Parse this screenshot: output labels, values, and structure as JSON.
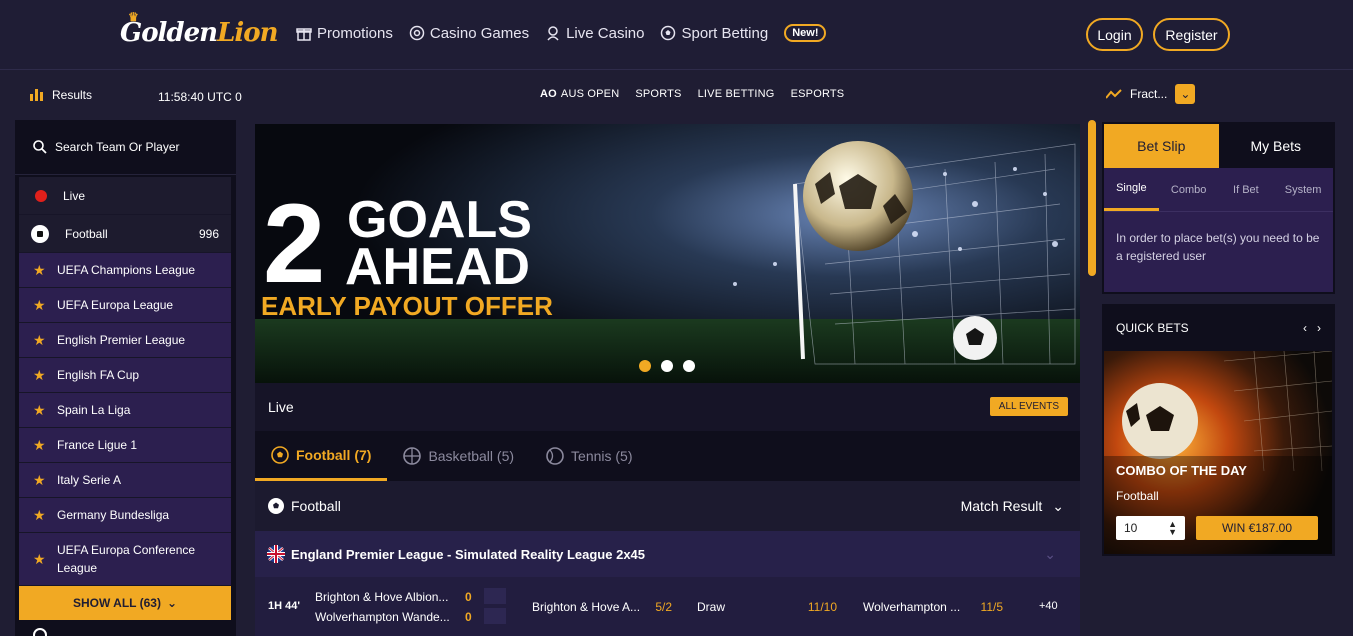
{
  "brand": {
    "logo_main": "Golden",
    "logo_accent": "Lion"
  },
  "nav": {
    "items": [
      {
        "label": "Promotions",
        "icon": "gift-icon"
      },
      {
        "label": "Casino Games",
        "icon": "casino-chip-icon"
      },
      {
        "label": "Live Casino",
        "icon": "live-dealer-icon"
      },
      {
        "label": "Sport Betting",
        "icon": "football-icon"
      }
    ],
    "new_badge": "New!",
    "login": "Login",
    "register": "Register"
  },
  "subbar": {
    "results": "Results",
    "clock": "11:58:40 UTC 0",
    "sports_nav": [
      "AUS OPEN",
      "SPORTS",
      "LIVE BETTING",
      "ESPORTS"
    ],
    "odds_format": "Fract..."
  },
  "left": {
    "search_placeholder": "Search Team Or Player",
    "live": "Live",
    "football": "Football",
    "football_count": "996",
    "leagues": [
      "UEFA Champions League",
      "UEFA Europa League",
      "English Premier League",
      "English FA Cup",
      "Spain La Liga",
      "France Ligue 1",
      "Italy Serie A",
      "Germany Bundesliga",
      "UEFA Europa Conference League"
    ],
    "show_all": "SHOW ALL (63)"
  },
  "banner": {
    "big_number": "2",
    "line1": "GOALS",
    "line2": "AHEAD",
    "offer": "EARLY PAYOUT OFFER",
    "slides": 3,
    "active_slide": 1
  },
  "live_section": {
    "title": "Live",
    "all_events": "ALL EVENTS",
    "tabs": [
      {
        "label": "Football (7)",
        "icon": "football-icon",
        "active": true
      },
      {
        "label": "Basketball (5)",
        "icon": "basketball-icon",
        "active": false
      },
      {
        "label": "Tennis (5)",
        "icon": "tennis-ball-icon",
        "active": false
      }
    ],
    "sport_title": "Football",
    "market": "Match Result",
    "league": "England Premier League - Simulated Reality League 2x45",
    "match": {
      "time": "1H 44'",
      "home": "Brighton & Hove Albion...",
      "away": "Wolverhampton Wande...",
      "home_score": "0",
      "away_score": "0",
      "odd1_team": "Brighton & Hove A...",
      "odd1": "5/2",
      "draw": "Draw",
      "odd_draw": "11/10",
      "odd2_team": "Wolverhampton ...",
      "odd2": "11/5",
      "more": "+40"
    }
  },
  "betslip": {
    "tabs": [
      "Bet Slip",
      "My Bets"
    ],
    "types": [
      "Single",
      "Combo",
      "If Bet",
      "System"
    ],
    "message": "In order to place bet(s) you need to be a registered user"
  },
  "quick_bets": {
    "title": "QUICK BETS",
    "card_title": "COMBO OF THE DAY",
    "card_sport": "Football",
    "stake": "10",
    "win": "WIN €187.00"
  },
  "colors": {
    "accent": "#f1a923",
    "bg": "#1f1d33",
    "panel": "#0f0e1c",
    "purple": "#2c1f4f"
  }
}
